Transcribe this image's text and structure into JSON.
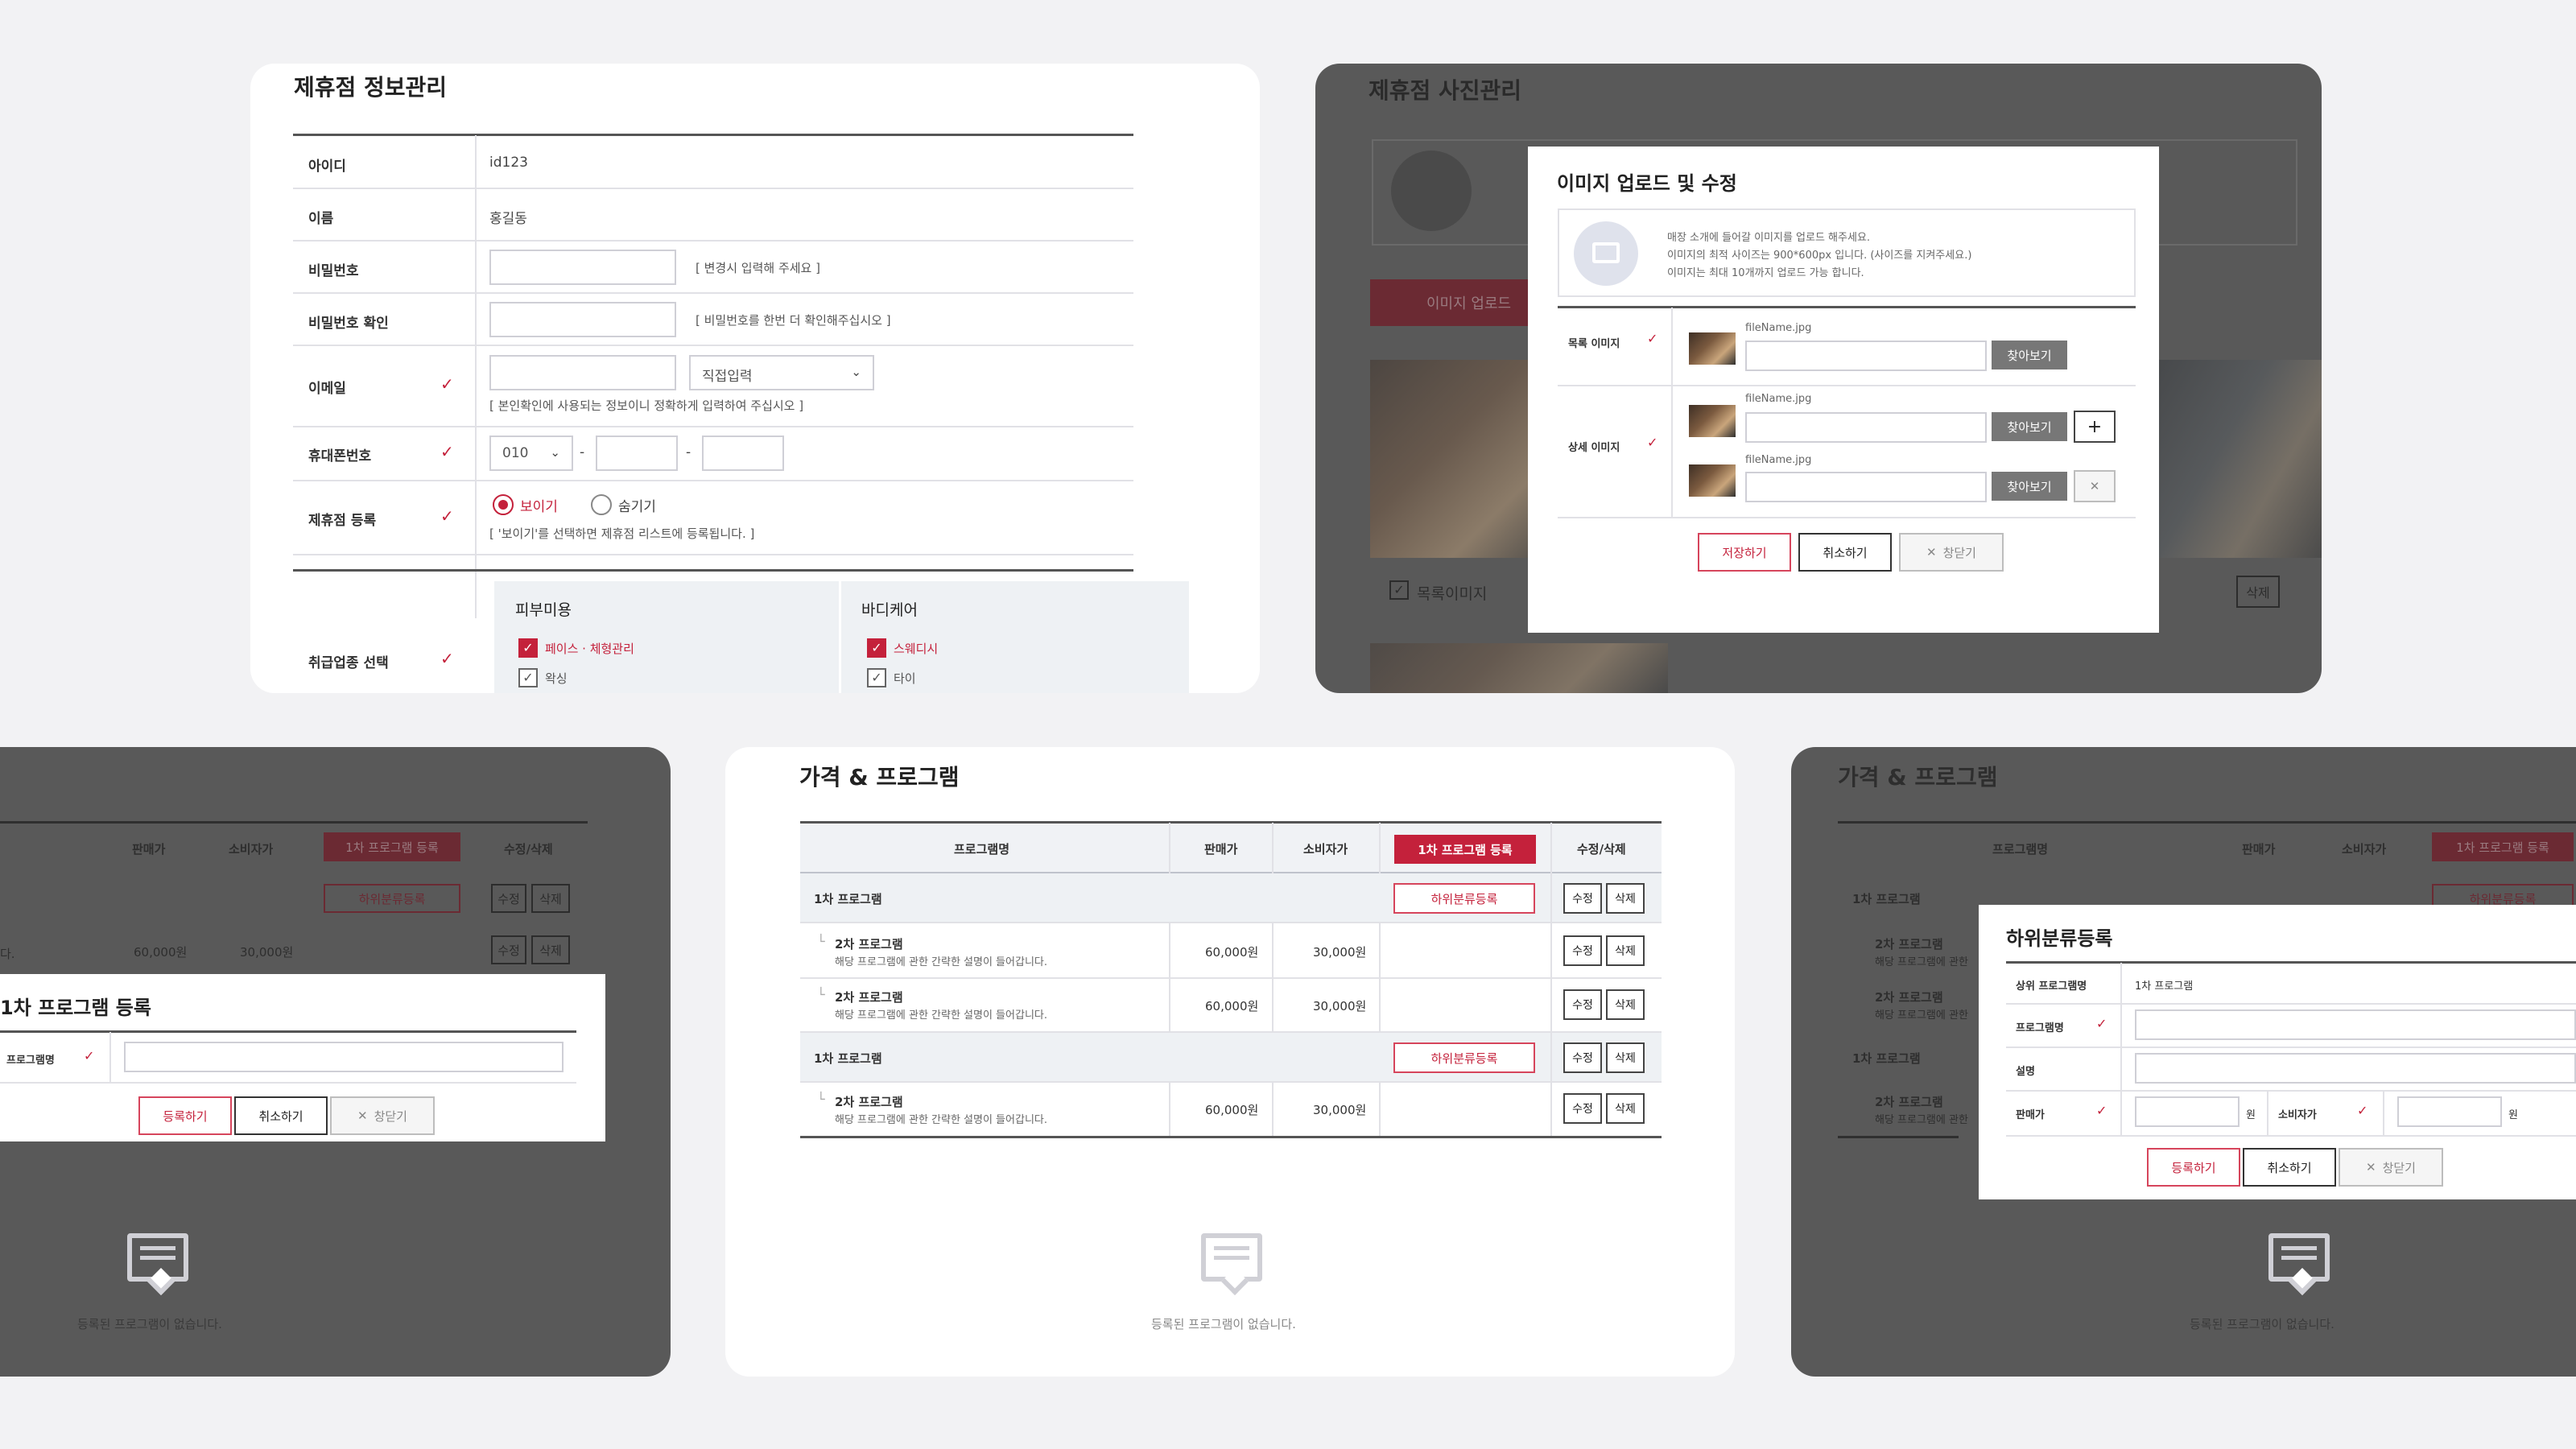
{
  "p1": {
    "title": "제휴점 정보관리",
    "id_label": "아이디",
    "id_value": "id123",
    "name_label": "이름",
    "name_value": "홍길동",
    "pw_label": "비밀번호",
    "pw_hint": "[ 변경시 입력해 주세요 ]",
    "pw2_label": "비밀번호 확인",
    "pw2_hint": "[ 비밀번호를 한번 더 확인해주십시오 ]",
    "email_label": "이메일",
    "email_select": "직접입력",
    "email_hint": "[ 본인확인에 사용되는 정보이니 정확하게 입력하여 주십시오 ]",
    "phone_label": "휴대폰번호",
    "phone_prefix": "010",
    "dash": "-",
    "reg_label": "제휴점 등록",
    "radio_show": "보이기",
    "radio_hide": "숨기기",
    "reg_hint": "[ '보이기'를 선택하면 제휴점 리스트에 등록됩니다. ]",
    "cat_label": "취급업종 선택",
    "cat1": "피부미용",
    "cat1_item1": "페이스 · 체형관리",
    "cat1_item2": "왁싱",
    "cat2": "바디케어",
    "cat2_item1": "스웨디시",
    "cat2_item2": "타이",
    "checkmark": "✓"
  },
  "p2": {
    "bg_title": "제휴점 사진관리",
    "bg_upload_btn": "이미지 업로드",
    "bg_check_label": "목록이미지",
    "bg_delete": "삭제",
    "modal_title": "이미지 업로드 및 수정",
    "notice_lines": [
      "매장 소개에 들어갈 이미지를 업로드 해주세요.",
      "이미지의 최적 사이즈는 900*600px 입니다. (사이즈를 지켜주세요.)",
      "이미지는 최대 10개까지 업로드 가능 합니다."
    ],
    "list_img_label": "목록 이미지",
    "detail_img_label": "상세 이미지",
    "filename": "fileName.jpg",
    "browse": "찾아보기",
    "plus": "+",
    "x": "✕",
    "save": "저장하기",
    "cancel": "취소하기",
    "close": "창닫기"
  },
  "p3": {
    "headers": [
      "판매가",
      "소비자가",
      "1차 프로그램 등록",
      "수정/삭제"
    ],
    "sub_reg": "하위분류등록",
    "edit": "수정",
    "del": "삭제",
    "price": "60,000원",
    "cprice": "30,000원",
    "row_partial": "다.",
    "modal_title": "1차 프로그램 등록",
    "field_label": "프로그램명",
    "register": "등록하기",
    "cancel": "취소하기",
    "close": "창닫기",
    "empty": "등록된 프로그램이 없습니다."
  },
  "p4": {
    "title": "가격 & 프로그램",
    "headers": [
      "프로그램명",
      "판매가",
      "소비자가",
      "1차 프로그램 등록",
      "수정/삭제"
    ],
    "rows": [
      {
        "kind": "first",
        "name": "1차 프로그램"
      },
      {
        "kind": "second",
        "name": "2차 프로그램",
        "desc": "해당 프로그램에 관한 간략한 설명이 들어갑니다.",
        "price": "60,000원",
        "cprice": "30,000원"
      },
      {
        "kind": "second",
        "name": "2차 프로그램",
        "desc": "해당 프로그램에 관한 간략한 설명이 들어갑니다.",
        "price": "60,000원",
        "cprice": "30,000원"
      },
      {
        "kind": "first",
        "name": "1차 프로그램"
      },
      {
        "kind": "second",
        "name": "2차 프로그램",
        "desc": "해당 프로그램에 관한 간략한 설명이 들어갑니다.",
        "price": "60,000원",
        "cprice": "30,000원"
      }
    ],
    "sub_reg": "하위분류등록",
    "edit": "수정",
    "del": "삭제",
    "empty": "등록된 프로그램이 없습니다."
  },
  "p5": {
    "bg_title": "가격 & 프로그램",
    "bg_headers": [
      "프로그램명",
      "판매가",
      "소비자가",
      "1차 프로그램 등록"
    ],
    "bg_rows": [
      "1차 프로그램",
      "2차 프로그램",
      "해당 프로그램에 관한",
      "2차 프로그램",
      "해당 프로그램에 관한",
      "1차 프로그램",
      "2차 프로그램",
      "해당 프로그램에 관한"
    ],
    "bg_sub_reg": "하위분류등록",
    "modal_title": "하위분류등록",
    "parent_label": "상위 프로그램명",
    "parent_value": "1차 프로그램",
    "name_label": "프로그램명",
    "desc_label": "설명",
    "price_label": "판매가",
    "won": "원",
    "cprice_label": "소비자가",
    "register": "등록하기",
    "cancel": "취소하기",
    "close": "창닫기",
    "empty": "등록된 프로그램이 없습니다."
  }
}
